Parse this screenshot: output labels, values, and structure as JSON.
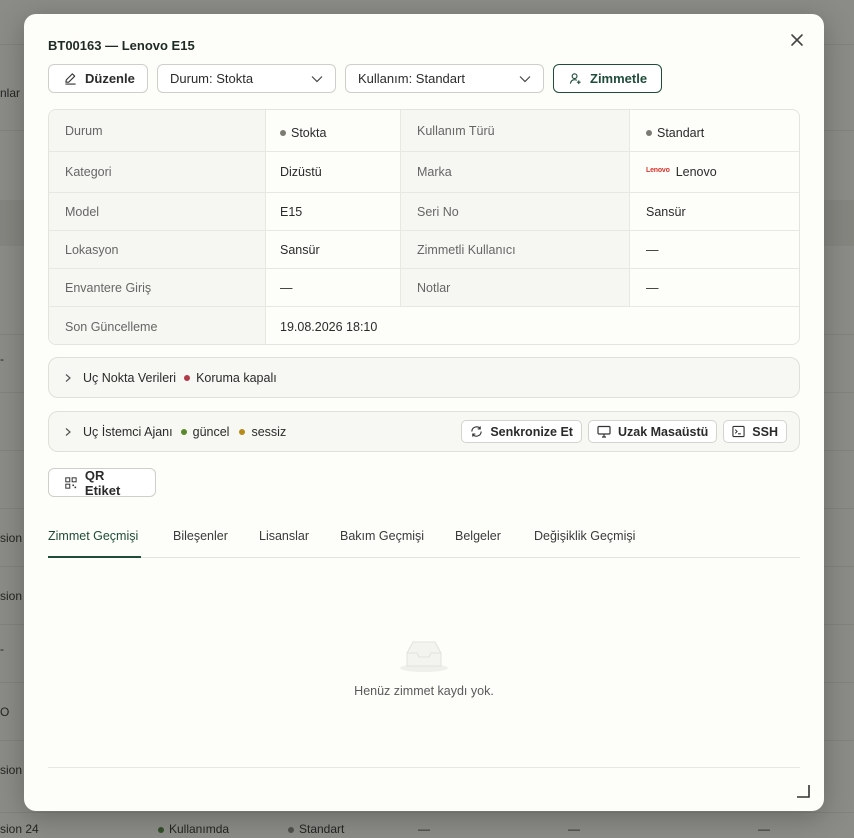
{
  "background": {
    "fragments": [
      {
        "id": "nlar",
        "text": "nlar"
      },
      {
        "id": "i",
        "text": "i"
      },
      {
        "id": "dash1",
        "text": "-"
      },
      {
        "id": "sion1",
        "text": "sion"
      },
      {
        "id": "sion2",
        "text": "sion"
      },
      {
        "id": "dash2",
        "text": "-"
      },
      {
        "id": "o",
        "text": "O"
      },
      {
        "id": "sion3",
        "text": "sion"
      },
      {
        "id": "sion24",
        "text": "sion 24"
      }
    ],
    "bottom_row": {
      "status": "Kullanımda",
      "usage": "Standart",
      "dash1": "—",
      "dash2": "—",
      "dash3": "—"
    },
    "colors": {
      "green": "#3f7a2e",
      "gray": "#7a7a74"
    }
  },
  "modal": {
    "title": "BT00163 — Lenovo E15",
    "toolbar": {
      "edit_label": "Düzenle",
      "status_select": "Durum: Stokta",
      "usage_select": "Kullanım: Standart",
      "assign_label": "Zimmetle"
    },
    "info": {
      "status_label": "Durum",
      "status_value": "Stokta",
      "usage_type_label": "Kullanım Türü",
      "usage_type_value": "Standart",
      "category_label": "Kategori",
      "category_value": "Dizüstü",
      "brand_label": "Marka",
      "brand_logo": "Lenovo",
      "brand_value": "Lenovo",
      "model_label": "Model",
      "model_value": "E15",
      "serial_label": "Seri No",
      "serial_value": "Sansür",
      "location_label": "Lokasyon",
      "location_value": "Sansür",
      "assigned_user_label": "Zimmetli Kullanıcı",
      "assigned_user_value": "—",
      "inventory_entry_label": "Envantere Giriş",
      "inventory_entry_value": "—",
      "notes_label": "Notlar",
      "notes_value": "—",
      "last_update_label": "Son Güncelleme",
      "last_update_value": "19.08.2026 18:10"
    },
    "endpoint": {
      "label": "Uç Nokta Verileri",
      "protection": "Koruma kapalı"
    },
    "agent": {
      "label": "Uç İstemci Ajanı",
      "version_status": "güncel",
      "mode_status": "sessiz",
      "sync_label": "Senkronize Et",
      "remote_desktop_label": "Uzak Masaüstü",
      "ssh_label": "SSH"
    },
    "qr_label": "QR Etiket",
    "tabs": [
      "Zimmet Geçmişi",
      "Bileşenler",
      "Lisanslar",
      "Bakım Geçmişi",
      "Belgeler",
      "Değişiklik Geçmişi"
    ],
    "active_tab": "Zimmet Geçmişi",
    "empty_message": "Henüz zimmet kaydı yok.",
    "colors": {
      "accent": "#1f4d3a",
      "status_gray": "#7b7b74",
      "protection_red": "#b03a48",
      "current_green": "#5a8a2c",
      "silent_amber": "#b78a1a",
      "lenovo_red": "#d9342b"
    }
  }
}
